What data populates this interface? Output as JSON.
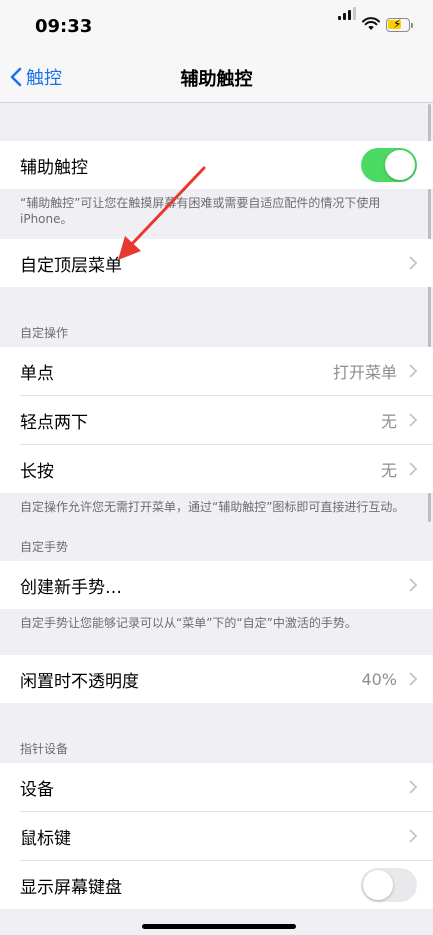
{
  "status": {
    "time": "09:33"
  },
  "nav": {
    "back_label": "触控",
    "title": "辅助触控"
  },
  "sections": {
    "main": {
      "toggle_label": "辅助触控",
      "toggle_on": true,
      "footer": "“辅助触控”可让您在触摸屏幕有困难或需要自适应配件的情况下使用iPhone。"
    },
    "top_menu": {
      "label": "自定顶层菜单"
    },
    "custom_actions": {
      "header": "自定操作",
      "rows": [
        {
          "label": "单点",
          "value": "打开菜单"
        },
        {
          "label": "轻点两下",
          "value": "无"
        },
        {
          "label": "长按",
          "value": "无"
        }
      ],
      "footer": "自定操作允许您无需打开菜单，通过“辅助触控”图标即可直接进行互动。"
    },
    "custom_gestures": {
      "header": "自定手势",
      "create_label": "创建新手势…",
      "footer": "自定手势让您能够记录可以从“菜单”下的“自定”中激活的手势。"
    },
    "idle_opacity": {
      "label": "闲置时不透明度",
      "value": "40%"
    },
    "pointer_devices": {
      "header": "指针设备",
      "rows": [
        {
          "label": "设备"
        },
        {
          "label": "鼠标键"
        }
      ],
      "onscreen_keyboard_label": "显示屏幕键盘",
      "onscreen_keyboard_on": false
    }
  },
  "colors": {
    "accent": "#1a73e8",
    "toggle_on": "#4cd964",
    "annotation_arrow": "#e8382f"
  }
}
